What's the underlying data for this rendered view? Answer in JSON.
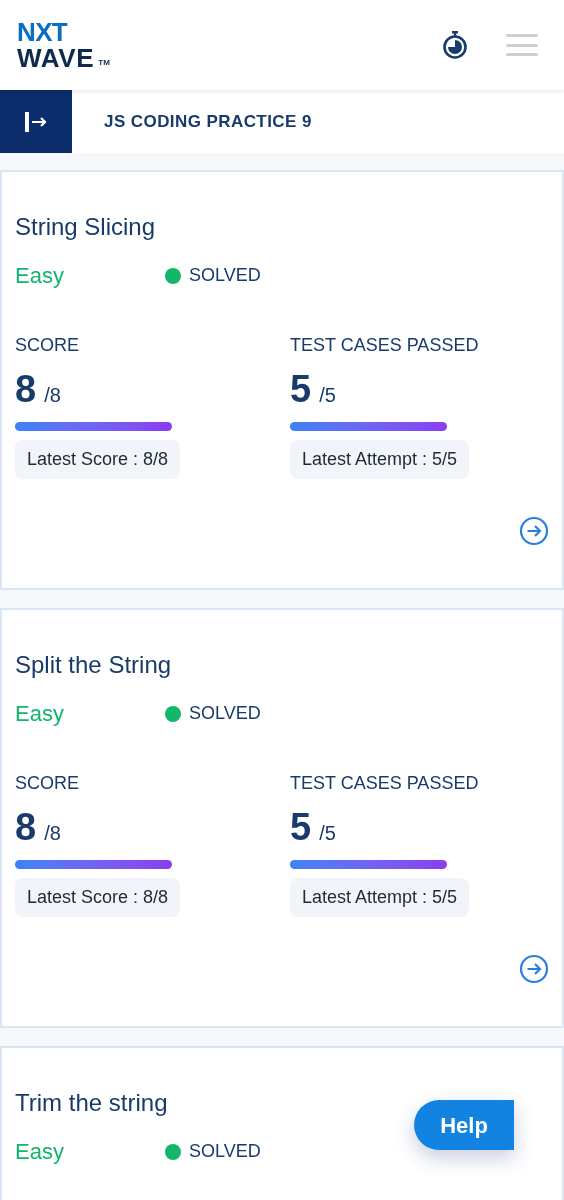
{
  "header": {
    "logo_top": "NXT",
    "logo_bottom": "WAVE",
    "logo_mark": "TM"
  },
  "banner": {
    "title": "JS CODING PRACTICE 9"
  },
  "questions": [
    {
      "title": "String Slicing",
      "difficulty": "Easy",
      "status": "SOLVED",
      "solved": true,
      "score": {
        "label": "SCORE",
        "value": "8",
        "total": "/8",
        "level": 1,
        "latest": "Latest Score : 8/8"
      },
      "tests": {
        "label": "TEST CASES PASSED",
        "value": "5",
        "total": "/5",
        "level": 1,
        "latest": "Latest Attempt : 5/5"
      }
    },
    {
      "title": "Split the String",
      "difficulty": "Easy",
      "status": "SOLVED",
      "solved": true,
      "score": {
        "label": "SCORE",
        "value": "8",
        "total": "/8",
        "level": 1,
        "latest": "Latest Score : 8/8"
      },
      "tests": {
        "label": "TEST CASES PASSED",
        "value": "5",
        "total": "/5",
        "level": 1,
        "latest": "Latest Attempt : 5/5"
      }
    },
    {
      "title": "Trim the string",
      "difficulty": "Easy",
      "status": "SOLVED",
      "solved": true
    }
  ],
  "help_button": "Help"
}
